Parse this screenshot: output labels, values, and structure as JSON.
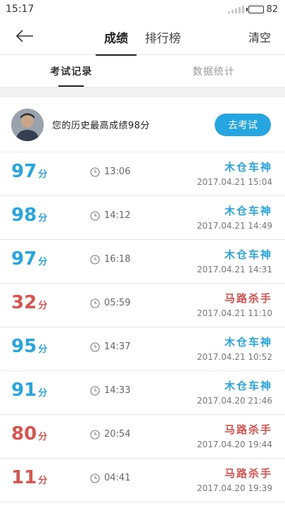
{
  "status_bar": {
    "time": "15:17",
    "battery": "82"
  },
  "nav": {
    "tabs": [
      "成绩",
      "排行榜"
    ],
    "clear_label": "清空"
  },
  "sub_tabs": [
    "考试记录",
    "数据统计"
  ],
  "best": {
    "text": "您的历史最高成绩98分",
    "button_label": "去考试"
  },
  "colors": {
    "accent": "#25a6e0",
    "good": "#25a6e0",
    "bad": "#d9534f"
  },
  "records": [
    {
      "score": "97",
      "unit": "分",
      "duration": "13:06",
      "label": "木仓车神",
      "date": "2017.04.21  15:04",
      "pass": true
    },
    {
      "score": "98",
      "unit": "分",
      "duration": "14:12",
      "label": "木仓车神",
      "date": "2017.04.21  14:49",
      "pass": true
    },
    {
      "score": "97",
      "unit": "分",
      "duration": "16:18",
      "label": "木仓车神",
      "date": "2017.04.21  14:31",
      "pass": true
    },
    {
      "score": "32",
      "unit": "分",
      "duration": "05:59",
      "label": "马路杀手",
      "date": "2017.04.21  11:10",
      "pass": false
    },
    {
      "score": "95",
      "unit": "分",
      "duration": "14:37",
      "label": "木仓车神",
      "date": "2017.04.21  10:52",
      "pass": true
    },
    {
      "score": "91",
      "unit": "分",
      "duration": "14:33",
      "label": "木仓车神",
      "date": "2017.04.20  21:46",
      "pass": true
    },
    {
      "score": "80",
      "unit": "分",
      "duration": "20:54",
      "label": "马路杀手",
      "date": "2017.04.20  19:44",
      "pass": false
    },
    {
      "score": "11",
      "unit": "分",
      "duration": "04:41",
      "label": "马路杀手",
      "date": "2017.04.20  19:39",
      "pass": false
    }
  ]
}
